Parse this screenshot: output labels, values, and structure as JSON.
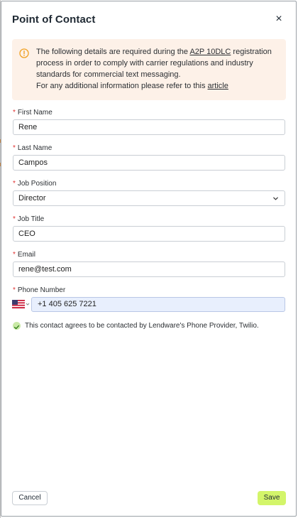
{
  "dialog": {
    "title": "Point of Contact",
    "close_glyph": "×"
  },
  "notice": {
    "icon": "info-circle-icon",
    "line1_pre": "The following details are required during the ",
    "line1_link": "A2P 10DLC",
    "line1_post": " registration",
    "line2": "process in order to comply with carrier regulations and industry",
    "line3": "standards for commercial text messaging.",
    "line4_pre": "For any additional information please refer to this ",
    "line4_link": "article"
  },
  "form": {
    "required_mark": "*",
    "first_name": {
      "label": "First Name",
      "value": "Rene"
    },
    "last_name": {
      "label": "Last Name",
      "value": "Campos"
    },
    "job_position": {
      "label": "Job Position",
      "value": "Director"
    },
    "job_title": {
      "label": "Job Title",
      "value": "CEO"
    },
    "email": {
      "label": "Email",
      "value": "rene@test.com"
    },
    "phone": {
      "label": "Phone Number",
      "value": "+1 405 625 7221",
      "country_flag": "us-flag-icon"
    }
  },
  "consent": {
    "checked": true,
    "text": "This contact agrees to be contacted by Lendware's Phone Provider, Twilio."
  },
  "footer": {
    "cancel_label": "Cancel",
    "save_label": "Save"
  },
  "colors": {
    "notice_bg": "#fdf1e8",
    "notice_icon": "#f0a020",
    "required": "#e03131",
    "save_bg": "#d3f56a",
    "phone_bg": "#e8effd",
    "consent_check": "#c9e9a6"
  }
}
